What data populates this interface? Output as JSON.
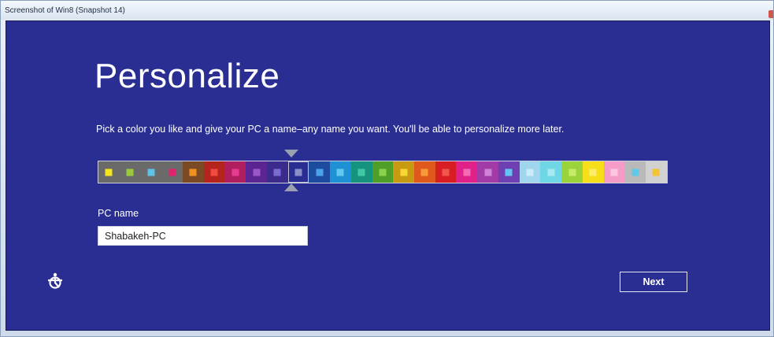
{
  "window": {
    "title": "Screenshot of Win8 (Snapshot 14)"
  },
  "setup": {
    "heading": "Personalize",
    "instruction": "Pick a color you like and give your PC a name–any name you want. You'll be able to personalize more later.",
    "pc_name_label": "PC name",
    "pc_name_value": "Shabakeh-PC",
    "next_label": "Next",
    "ease_of_access_icon": "ease-of-access-icon"
  },
  "palette": {
    "selected_index": 9,
    "swatches": [
      {
        "bg": "#6a6a6a",
        "dot": "#f4e41d"
      },
      {
        "bg": "#6a6a6a",
        "dot": "#9bc93d"
      },
      {
        "bg": "#6a6a6a",
        "dot": "#5dc3e6"
      },
      {
        "bg": "#6a6a6a",
        "dot": "#e0226f"
      },
      {
        "bg": "#7a4a24",
        "dot": "#f29120"
      },
      {
        "bg": "#b5231d",
        "dot": "#ef4a3d"
      },
      {
        "bg": "#b01e5f",
        "dot": "#e63b92"
      },
      {
        "bg": "#5b2493",
        "dot": "#9b57c8"
      },
      {
        "bg": "#3a2b8c",
        "dot": "#7b6bd0"
      },
      {
        "bg": "#2a2e93",
        "dot": "#8a8fc9"
      },
      {
        "bg": "#1d4b9d",
        "dot": "#4aa3e8"
      },
      {
        "bg": "#1e91d4",
        "dot": "#63c8f0"
      },
      {
        "bg": "#15937f",
        "dot": "#40c7a3"
      },
      {
        "bg": "#4e9e27",
        "dot": "#8cd14a"
      },
      {
        "bg": "#c79a11",
        "dot": "#f7d534"
      },
      {
        "bg": "#e0591c",
        "dot": "#f79b38"
      },
      {
        "bg": "#d81e22",
        "dot": "#f0564a"
      },
      {
        "bg": "#e0218a",
        "dot": "#f46bb4"
      },
      {
        "bg": "#a23aa8",
        "dot": "#cf82d6"
      },
      {
        "bg": "#6f3fb4",
        "dot": "#64c4f1"
      },
      {
        "bg": "#9fd6ee",
        "dot": "#c9ecf8"
      },
      {
        "bg": "#6fd6e6",
        "dot": "#a8eaf2"
      },
      {
        "bg": "#9bd43a",
        "dot": "#c7ec6a"
      },
      {
        "bg": "#f6df18",
        "dot": "#fbed6a"
      },
      {
        "bg": "#f59bc8",
        "dot": "#fbc7e2"
      },
      {
        "bg": "#b9b9b9",
        "dot": "#5ec9e8"
      },
      {
        "bg": "#d1d1d1",
        "dot": "#f2c434"
      }
    ]
  },
  "colors": {
    "background": "#2a2e93",
    "text": "#ffffff",
    "marker": "#9aa0b0"
  }
}
